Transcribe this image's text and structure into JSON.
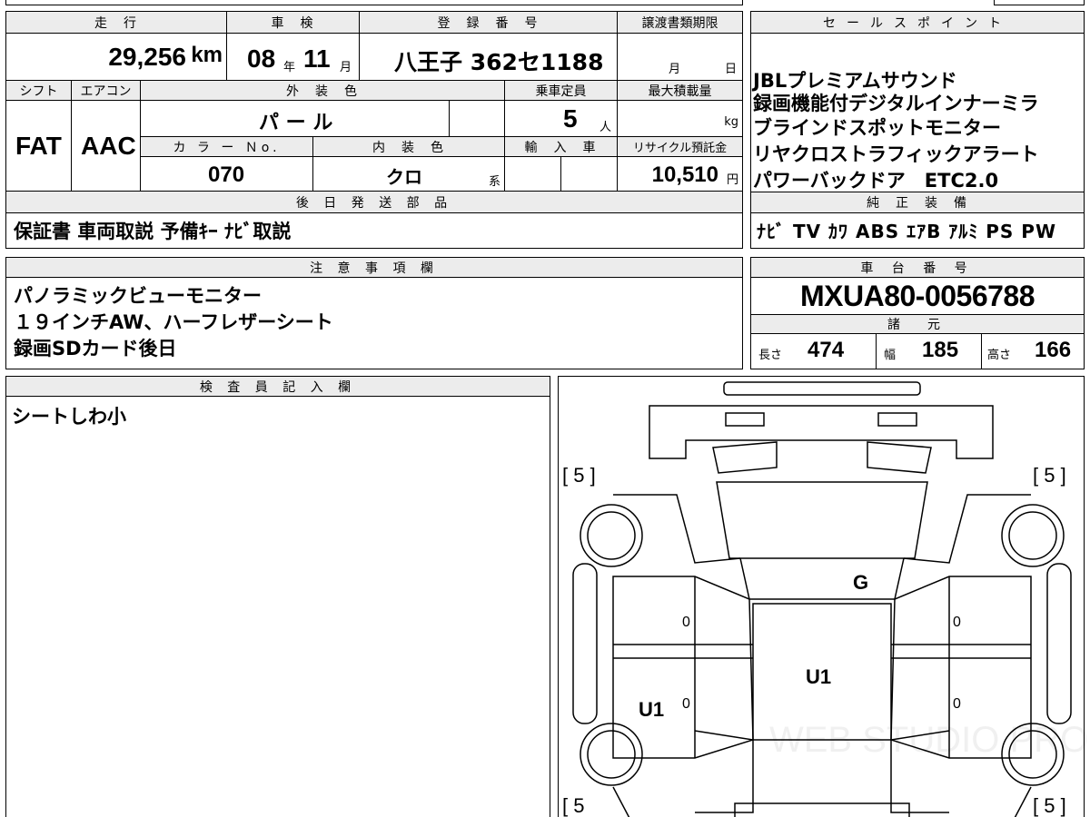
{
  "vehicle": {
    "header_labels": {
      "mileage": "走　行",
      "inspection": "車　検",
      "registration": "登　録　番　号",
      "transfer_deadline": "譲渡書類期限",
      "shift": "シフト",
      "aircon": "エアコン",
      "exterior": "外　装　色",
      "capacity": "乗車定員",
      "max_load": "最大積載量",
      "color_no": "カ ラ ー Ｎo.",
      "interior": "内　装　色",
      "import": "輸　入　車",
      "recycle": "リサイクル預託金"
    },
    "mileage": "29,256",
    "mileage_unit": "km",
    "inspection_year": "08",
    "inspection_year_unit": "年",
    "inspection_month": "11",
    "inspection_month_unit": "月",
    "registration_number": "八王子 362セ1188",
    "deadline_month_unit": "月",
    "deadline_day_unit": "日",
    "shift": "FAT",
    "aircon": "AAC",
    "exterior_color": "パ ー ル",
    "capacity": "5",
    "capacity_unit": "人",
    "max_load_unit": "kg",
    "color_no": "070",
    "interior_color": "クロ",
    "interior_suffix": "系",
    "recycle_fee": "10,510",
    "recycle_unit": "円"
  },
  "sales_points": {
    "title": "セールスポイント",
    "lines": [
      "JBLプレミアムサウンド",
      "録画機能付デジタルインナーミラ",
      "ブラインドスポットモニター",
      "リヤクロストラフィックアラート",
      "パワーバックドア　ETC2.0"
    ]
  },
  "later_parts": {
    "title": "後 日 発 送 部 品",
    "text": "保証書 車両取説 予備ｷｰ ﾅﾋﾞ取説"
  },
  "equipment": {
    "title": "純　正　装　備",
    "text": "ﾅﾋﾞ TV ｶﾜ ABS ｴｱB ｱﾙﾐ PS PW"
  },
  "notes": {
    "title": "注 意 事 項 欄",
    "lines": [
      "パノラミックビューモニター",
      "１９インチAW、ハーフレザーシート",
      "録画SDカード後日"
    ]
  },
  "chassis": {
    "title": "車 台 番 号",
    "number": "MXUA80-0056788",
    "spec_title": "諸　元",
    "length_label": "長さ",
    "length": "474",
    "width_label": "幅",
    "width": "185",
    "height_label": "高さ",
    "height": "166"
  },
  "inspector": {
    "title": "検 査 員 記 入 欄",
    "text": "シートしわ小"
  },
  "diagram": {
    "tire_front_left": "[ 5 ]",
    "tire_front_right": "[ 5 ]",
    "tire_rear_left": "[ 5",
    "tire_rear_right": "[ 5 ]",
    "mark_windshield": "G",
    "mark_roof": "U1",
    "mark_left_door": "U1",
    "zero": "0",
    "watermark": "WEB STUDIO PRO"
  }
}
